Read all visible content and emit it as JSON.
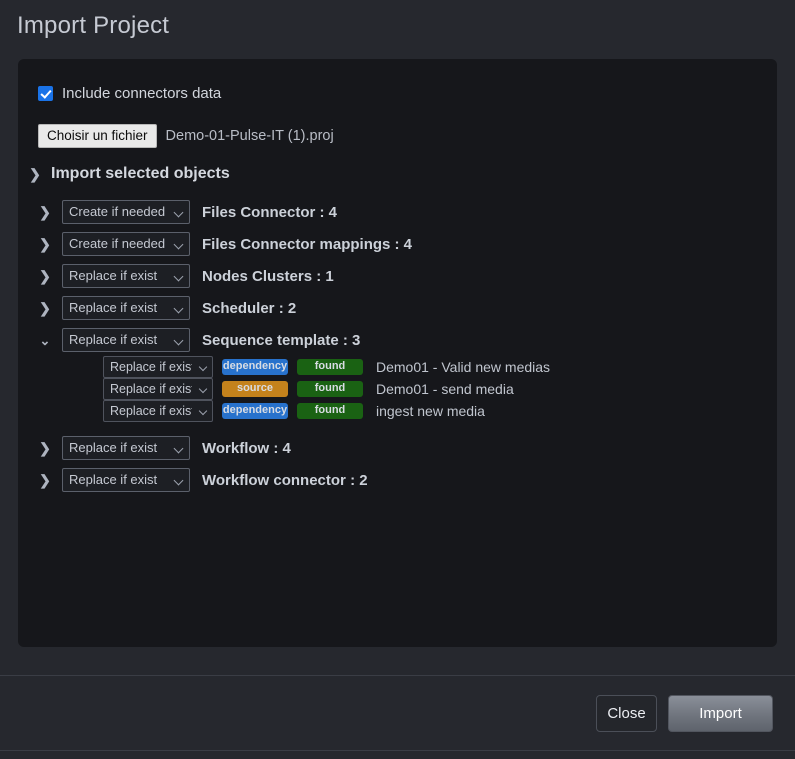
{
  "page_title": "Import Project",
  "panel": {
    "include_connectors": {
      "label": "Include connectors data",
      "checked": true
    },
    "file_input": {
      "button_label": "Choisir un fichier",
      "file_name": "Demo-01-Pulse-IT (1).proj"
    },
    "section": {
      "title": "Import selected objects",
      "chevron": "chevron-right-icon",
      "glyph": "❯"
    },
    "rows": [
      {
        "chevron": "chevron-right-icon",
        "glyph": "❯",
        "expanded": false,
        "select_value": "Create if needed",
        "label": "Files Connector : 4"
      },
      {
        "chevron": "chevron-right-icon",
        "glyph": "❯",
        "expanded": false,
        "select_value": "Create if needed",
        "label": "Files Connector mappings : 4"
      },
      {
        "chevron": "chevron-right-icon",
        "glyph": "❯",
        "expanded": false,
        "select_value": "Replace if exist",
        "label": "Nodes Clusters : 1"
      },
      {
        "chevron": "chevron-right-icon",
        "glyph": "❯",
        "expanded": false,
        "select_value": "Replace if exist",
        "label": "Scheduler : 2"
      },
      {
        "chevron": "chevron-down-icon",
        "glyph": "⌄",
        "expanded": true,
        "select_value": "Replace if exist",
        "label": "Sequence template : 3",
        "children": [
          {
            "select_value": "Replace if exist",
            "kind_badge": "dependency",
            "status_badge": "found",
            "label": "Demo01 - Valid new medias"
          },
          {
            "select_value": "Replace if exist",
            "kind_badge": "source",
            "status_badge": "found",
            "label": "Demo01 - send media"
          },
          {
            "select_value": "Replace if exist",
            "kind_badge": "dependency",
            "status_badge": "found",
            "label": "ingest new media"
          }
        ]
      },
      {
        "chevron": "chevron-right-icon",
        "glyph": "❯",
        "expanded": false,
        "select_value": "Replace if exist",
        "label": "Workflow : 4"
      },
      {
        "chevron": "chevron-right-icon",
        "glyph": "❯",
        "expanded": false,
        "select_value": "Replace if exist",
        "label": "Workflow connector : 2"
      }
    ],
    "select_options": [
      "Create if needed",
      "Replace if exist"
    ]
  },
  "footer": {
    "close_label": "Close",
    "import_label": "Import"
  },
  "colors": {
    "page_background": "#26282e",
    "panel_background": "#16171b",
    "checkbox_accent": "#1a73e8",
    "badge_dependency": "#2872cc",
    "badge_source": "#c4821c",
    "badge_found": "#1a6213",
    "import_button": "#70757e"
  }
}
